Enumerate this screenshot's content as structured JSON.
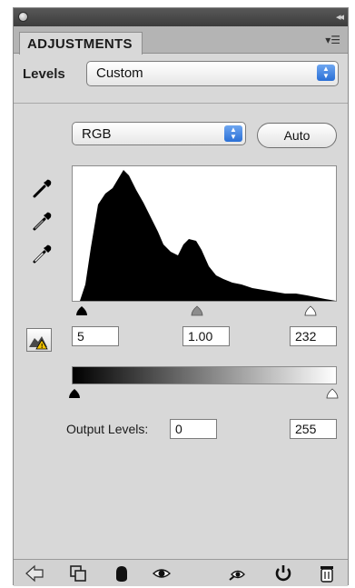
{
  "panel": {
    "tab_label": "ADJUSTMENTS",
    "menu_icon": "panel-menu-icon"
  },
  "levels": {
    "label": "Levels",
    "preset_value": "Custom"
  },
  "channel": {
    "value": "RGB"
  },
  "auto_button": {
    "label": "Auto"
  },
  "input_levels": {
    "black": "5",
    "gamma": "1.00",
    "white": "232"
  },
  "output_levels": {
    "label": "Output Levels:",
    "black": "0",
    "white": "255"
  },
  "icons": {
    "black_eyedropper": "black-point-eyedropper-icon",
    "gray_eyedropper": "gray-point-eyedropper-icon",
    "white_eyedropper": "white-point-eyedropper-icon",
    "clipping_warning": "clipping-warning-icon",
    "bottom": [
      "back-arrow-icon",
      "clip-to-layer-icon",
      "mask-visibility-icon",
      "eye-icon",
      "view-previous-state-icon",
      "reset-icon",
      "trash-icon"
    ]
  },
  "colors": {
    "panel_bg": "#d8d8d8",
    "titlebar": "#484848",
    "select_arrow": "#2a6fd6"
  }
}
